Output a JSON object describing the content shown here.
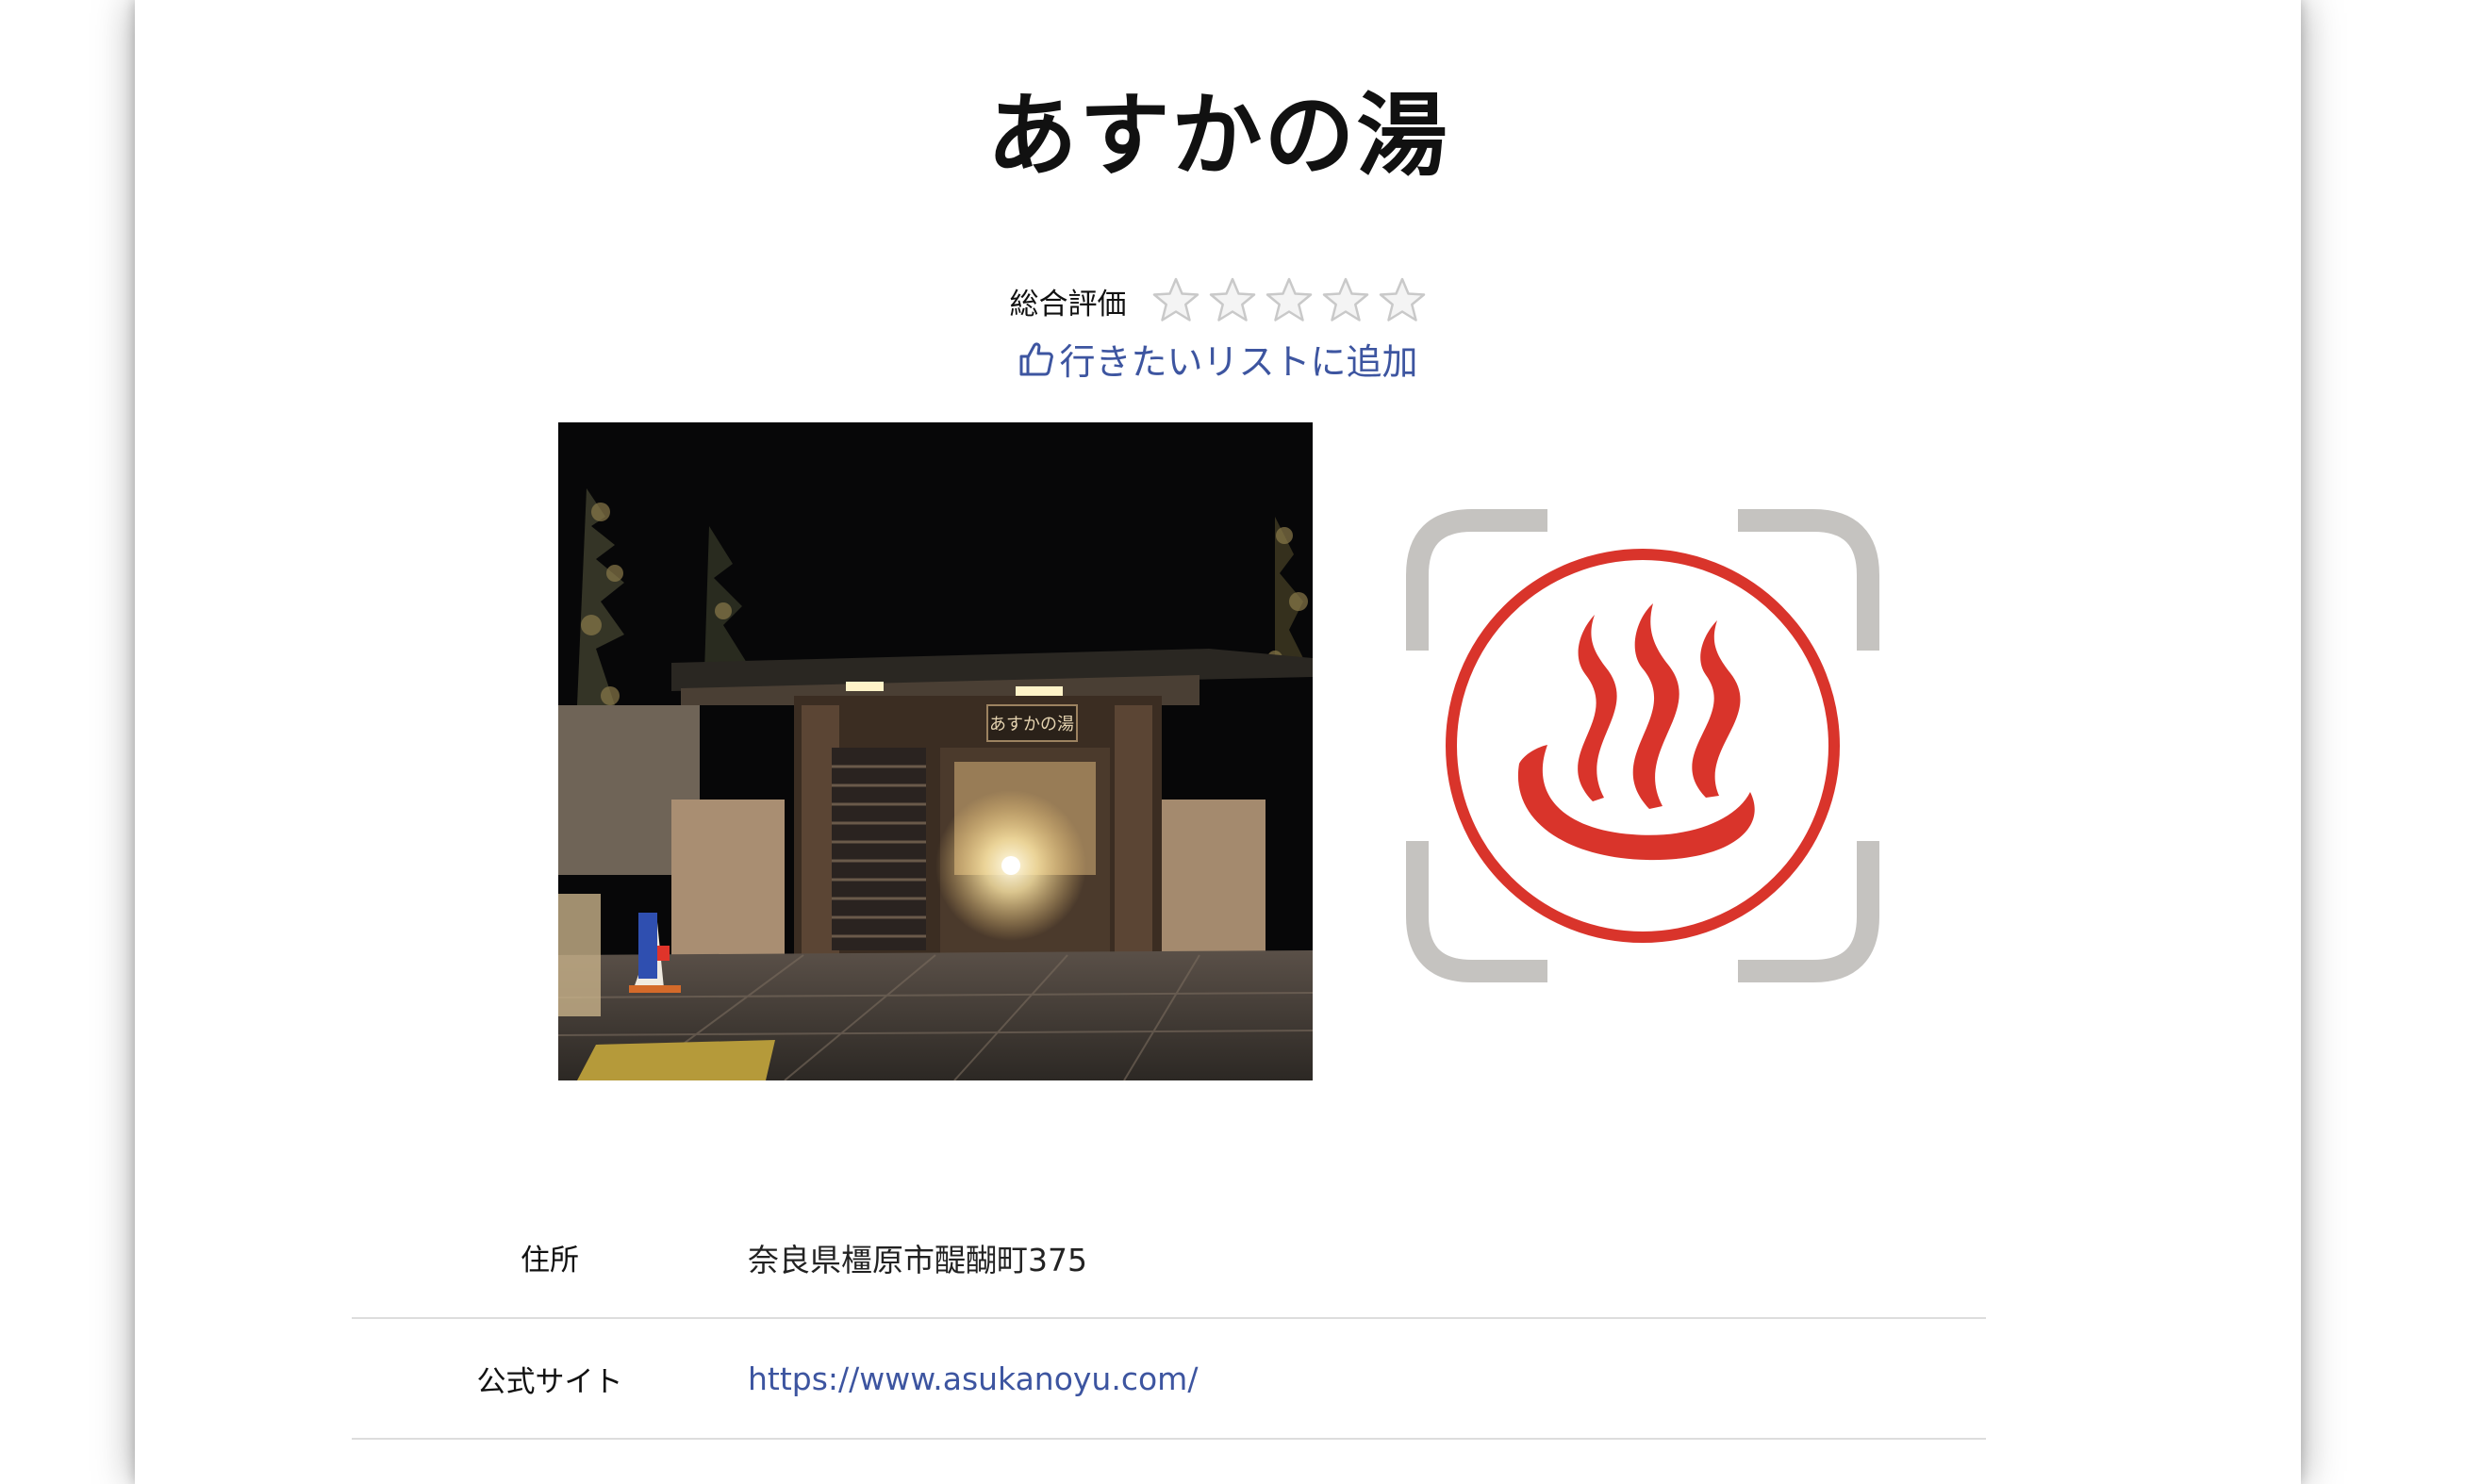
{
  "page": {
    "title": "あすかの湯"
  },
  "rating": {
    "label": "総合評価",
    "value": 0,
    "max": 5,
    "star_icon": "star-outline-icon"
  },
  "wishlist": {
    "label": "行きたいリストに追加",
    "icon": "thumbs-up-icon"
  },
  "photo": {
    "sign_text": "あすかの湯"
  },
  "logo": {
    "icon": "hot-spring-icon",
    "accent": "#d9342b",
    "frame_color": "#c5c3c0"
  },
  "info": [
    {
      "label": "住所",
      "value": "奈良県橿原市醍醐町375",
      "type": "text"
    },
    {
      "label": "公式サイト",
      "value": "https://www.asukanoyu.com/",
      "type": "link"
    }
  ],
  "colors": {
    "link": "#3d55a0",
    "text": "#111111",
    "divider": "#dddddd"
  }
}
